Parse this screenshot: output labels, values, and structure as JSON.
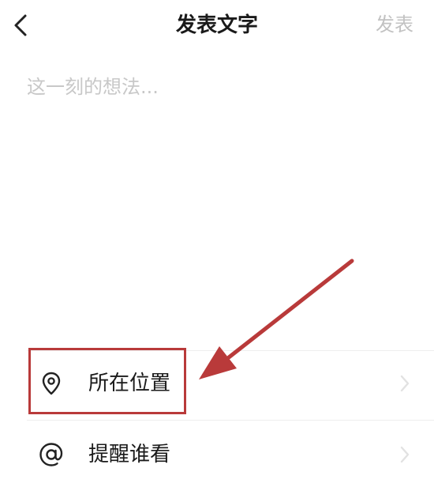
{
  "header": {
    "title": "发表文字",
    "publish_label": "发表"
  },
  "compose": {
    "placeholder": "这一刻的想法..."
  },
  "options": [
    {
      "label": "所在位置",
      "icon": "location-pin-icon"
    },
    {
      "label": "提醒谁看",
      "icon": "at-sign-icon"
    }
  ],
  "colors": {
    "annotation": "#b93a3a",
    "publish_disabled": "#c2c2c2",
    "placeholder": "#c8c8c8"
  }
}
